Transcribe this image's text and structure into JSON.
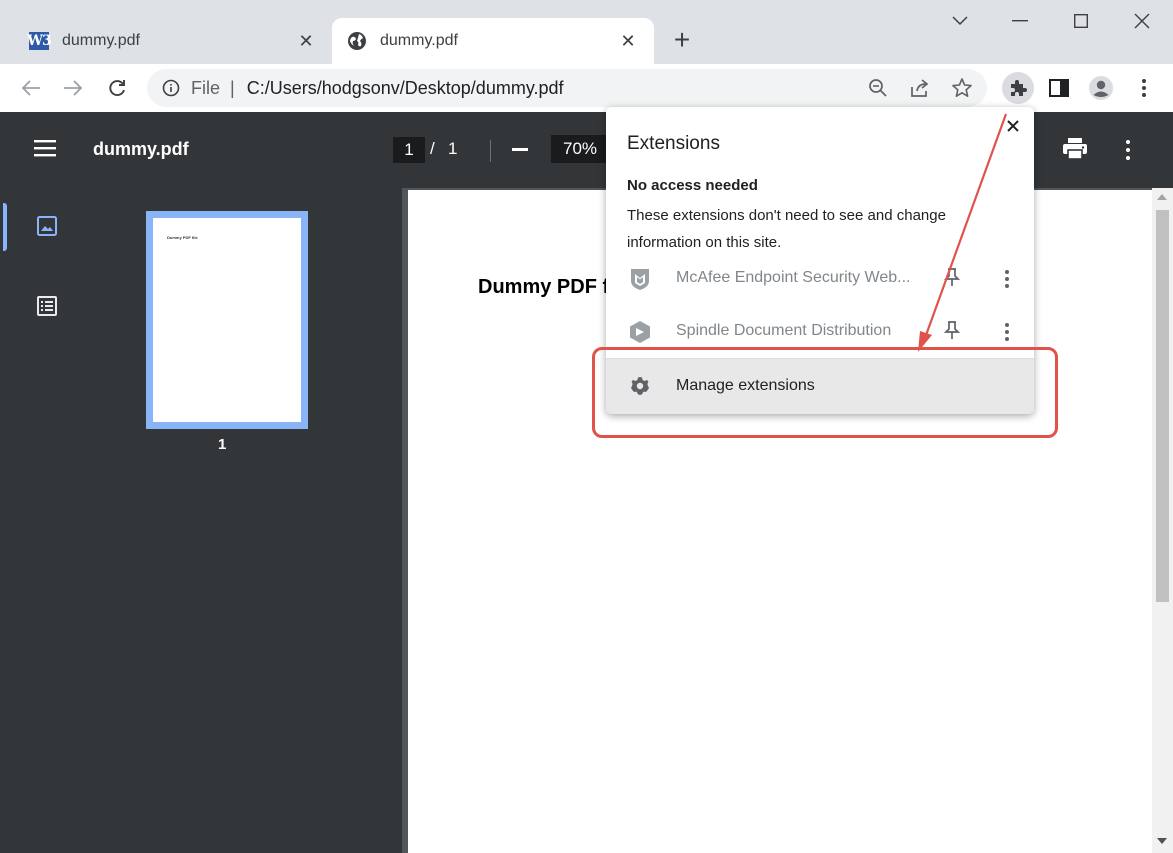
{
  "browser": {
    "tabs": [
      {
        "title": "dummy.pdf",
        "favicon": "w3-icon",
        "favicon_text": "W3",
        "active": false
      },
      {
        "title": "dummy.pdf",
        "favicon": "globe-icon",
        "active": true
      }
    ],
    "tab_close": "✕",
    "new_tab": "+",
    "address": {
      "scheme_label": "File",
      "separator": "|",
      "url": "C:/Users/hodgsonv/Desktop/dummy.pdf"
    }
  },
  "pdf_viewer": {
    "title": "dummy.pdf",
    "current_page": "1",
    "page_separator": "/",
    "total_pages": "1",
    "zoom": "70%",
    "thumbnail_label": "1",
    "thumbnail_text": "Dummy PDF file",
    "document_heading": "Dummy PDF f"
  },
  "extensions_popup": {
    "title": "Extensions",
    "section_heading": "No access needed",
    "section_description": "These extensions don't need to see and change information on this site.",
    "items": [
      {
        "name": "McAfee Endpoint Security Web...",
        "icon": "mcafee-shield-icon"
      },
      {
        "name": "Spindle Document Distribution",
        "icon": "spindle-icon"
      }
    ],
    "manage_label": "Manage extensions"
  },
  "annotation": {
    "color": "#e0534a"
  },
  "colors": {
    "tabstrip": "#dee1e6",
    "pdf_toolbar": "#323639",
    "thumbnail_accent": "#8ab4f8"
  }
}
